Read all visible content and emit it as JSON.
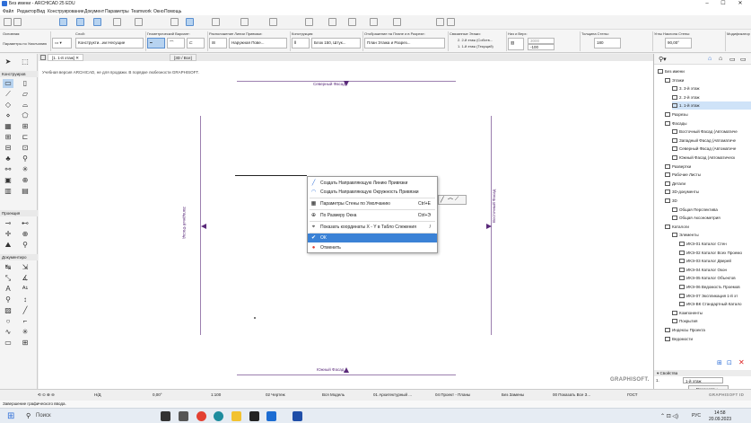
{
  "window": {
    "title": "Без имени - ARCHICAD 25 EDU",
    "minimize": "–",
    "maximize": "☐",
    "close": "✕"
  },
  "menu": [
    "Файл",
    "Редактор",
    "Вид",
    "Конструирование",
    "Документ",
    "Параметры",
    "Teamwork",
    "Окно",
    "Помощь"
  ],
  "infobox": {
    "sections": [
      {
        "label": "Основная:",
        "value": "Параметры по Умолчанию"
      },
      {
        "label": "Слой:",
        "value": "Конструкти...ии Несущие"
      },
      {
        "label": "Геометрический Вариант:",
        "value": ""
      },
      {
        "label": "Расположение Линии Привязки:",
        "value": "Наружная Пове..."
      },
      {
        "label": "Конструкция:",
        "value": "Блок 150, Штук..."
      },
      {
        "label": "Отображение на Плане и в Разрезе:",
        "value": "План Этажа и Разрез..."
      },
      {
        "label": "Связанные Этажи:",
        "top": "2. 2-й этаж (Собств...",
        "bottom": "1. 1-й этаж (Текущий)",
        "top_value": "3000",
        "bottom_value": "-100"
      },
      {
        "label": "Низ и Верх:",
        "value": ""
      },
      {
        "label": "Толщина Стены:",
        "value": "180"
      },
      {
        "label": "Углы Наклона Стены:",
        "value": "90,00°"
      },
      {
        "label": "Модификатор",
        "value": ""
      }
    ]
  },
  "tabs": [
    {
      "label": "[1. 1-й этаж]"
    },
    {
      "label": "[3D / Все]"
    }
  ],
  "toolbox": {
    "sections": [
      "Конструиров",
      "Проекция",
      "Документиро"
    ]
  },
  "canvas": {
    "warning": "Учебная версия ARCHICAD, не для продажи. В порядке любезности GRAPHISOFT.",
    "north": "Северный Фасад",
    "south": "Южный Фасад",
    "west": "Западный Фасад",
    "east": "Восточный Фасад",
    "brand": "GRAPHISOFT."
  },
  "context_menu": [
    {
      "icon": "guide-line-icon",
      "glyph": "╱",
      "label": "Создать Направляющую Линию Привязки",
      "shortcut": ""
    },
    {
      "icon": "guide-circle-icon",
      "glyph": "◠",
      "label": "Создать Направляющую Окружность Привязки",
      "shortcut": ""
    },
    {
      "icon": "wall-settings-icon",
      "glyph": "▦",
      "label": "Параметры Стены по Умолчанию",
      "shortcut": "Ctrl+E"
    },
    {
      "icon": "fit-window-icon",
      "glyph": "⊕",
      "label": "По Размеру Окна",
      "shortcut": "Ctrl+Э"
    },
    {
      "icon": "tracker-icon",
      "glyph": "⌖",
      "label": "Показать координаты X - Y в Табло Слежения",
      "shortcut": "/"
    },
    {
      "icon": "ok-icon",
      "glyph": "✔",
      "label": "ОК",
      "shortcut": ""
    },
    {
      "icon": "cancel-icon",
      "glyph": "●",
      "label": "Отменить",
      "shortcut": ""
    }
  ],
  "navigator": {
    "items": [
      {
        "label": "Без имени",
        "indent": 0
      },
      {
        "label": "Этажи",
        "indent": 1
      },
      {
        "label": "3. 3-й этаж",
        "indent": 2
      },
      {
        "label": "2. 2-й этаж",
        "indent": 2
      },
      {
        "label": "1. 1-й этаж",
        "indent": 2,
        "selected": true
      },
      {
        "label": "Разрезы",
        "indent": 1
      },
      {
        "label": "Фасады",
        "indent": 1
      },
      {
        "label": "Восточный Фасад (Автоматиче",
        "indent": 2
      },
      {
        "label": "Западный Фасад (Автоматиче",
        "indent": 2
      },
      {
        "label": "Северный Фасад (Автоматиче",
        "indent": 2
      },
      {
        "label": "Южный Фасад (Автоматическ",
        "indent": 2
      },
      {
        "label": "Развертки",
        "indent": 1
      },
      {
        "label": "Рабочие Листы",
        "indent": 1
      },
      {
        "label": "Детали",
        "indent": 1
      },
      {
        "label": "3D-документы",
        "indent": 1
      },
      {
        "label": "3D",
        "indent": 1
      },
      {
        "label": "Общая Перспектива",
        "indent": 2
      },
      {
        "label": "Общая Аксонометрия",
        "indent": 2
      },
      {
        "label": "Каталоги",
        "indent": 1
      },
      {
        "label": "Элементы",
        "indent": 2
      },
      {
        "label": "ИКЭ-01 Каталог Стен",
        "indent": 3
      },
      {
        "label": "ИКЭ-02 Каталог Всех Проемо",
        "indent": 3
      },
      {
        "label": "ИКЭ-03 Каталог Дверей",
        "indent": 3
      },
      {
        "label": "ИКЭ-04 Каталог Окон",
        "indent": 3
      },
      {
        "label": "ИКЭ-05 Каталог Объектов",
        "indent": 3
      },
      {
        "label": "ИКЭ-06 Ведомость Проемов",
        "indent": 3
      },
      {
        "label": "ИКЭ-07 Экспликация 1-й эт",
        "indent": 3
      },
      {
        "label": "ИКЭ-ВК Стандартный Катало",
        "indent": 3
      },
      {
        "label": "Компоненты",
        "indent": 2
      },
      {
        "label": "Покрытия",
        "indent": 2
      },
      {
        "label": "Индексы Проекта",
        "indent": 1
      },
      {
        "label": "Ведомости",
        "indent": 1
      }
    ],
    "properties_title": "Свойства",
    "properties_row_id": "1.",
    "properties_row_value": "1-й этаж",
    "parameters_button": "Параметры...",
    "brand": "GRAPHISOFT ID"
  },
  "statusbar": {
    "items": [
      "Н/Д",
      "0,00°",
      "1:100",
      "02 Чертеж",
      "Вся Модель",
      "01 Архитектурный ...",
      "04 Проект - Планы",
      "Без Замены",
      "00 Показать Все З...",
      "ГОСТ"
    ]
  },
  "statusline": "Завершение графического ввода.",
  "taskbar": {
    "search": "Поиск",
    "lang": "РУС",
    "time": "14:58",
    "date": "20.09.2023"
  },
  "colors": {
    "accent": "#2f6fd8",
    "marker": "#5a2a7a",
    "selected": "#cfe3f8",
    "highlight": "#3b82d6"
  }
}
